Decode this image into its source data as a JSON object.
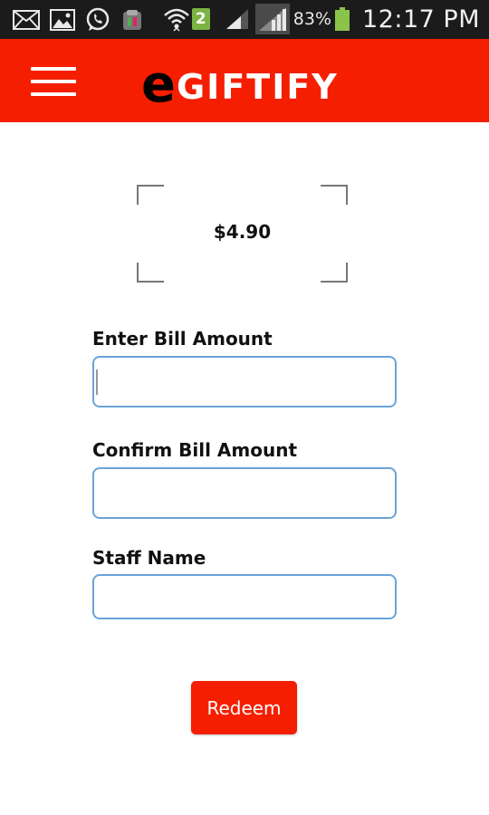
{
  "status_bar": {
    "icons": [
      "mail-icon",
      "gallery-icon",
      "whatsapp-icon",
      "app-icon",
      "wifi-icon",
      "notification-badge",
      "signal-icon",
      "signal-icon-2",
      "battery-icon"
    ],
    "badge": "2",
    "battery_percent": "83%",
    "time": "12:17 PM"
  },
  "app_bar": {
    "logo_e": "e",
    "logo_rest": "GIFTIFY",
    "background": "#f51e00"
  },
  "voucher": {
    "amount": "$4.90"
  },
  "form": {
    "bill_amount_label": "Enter Bill Amount",
    "bill_amount_value": "",
    "confirm_amount_label": "Confirm Bill Amount",
    "confirm_amount_value": "",
    "staff_name_label": "Staff Name",
    "staff_name_value": ""
  },
  "actions": {
    "redeem_label": "Redeem"
  },
  "colors": {
    "accent": "#f51e00",
    "field_border": "#6aa3d8"
  }
}
